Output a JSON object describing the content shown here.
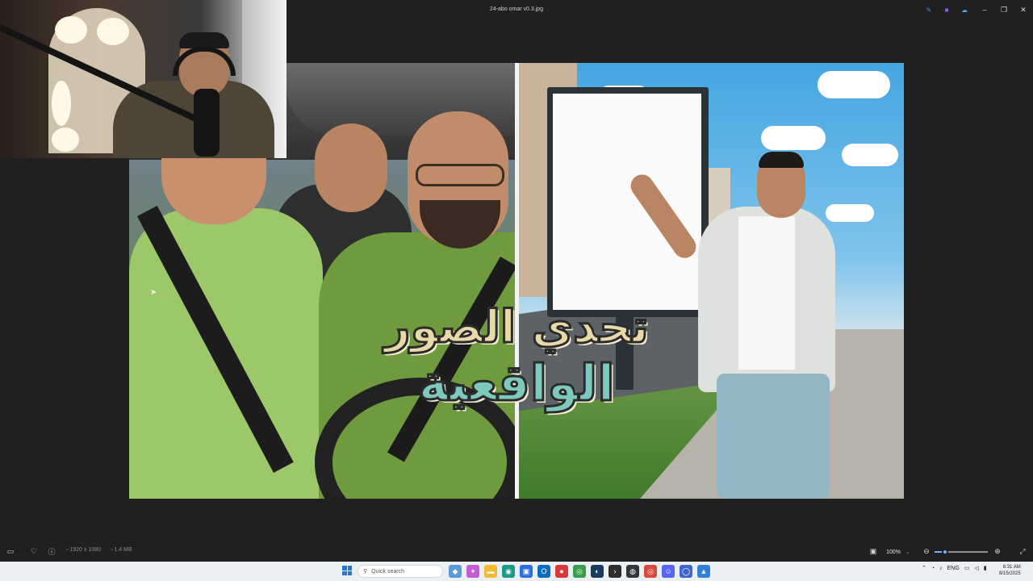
{
  "window": {
    "title": "24-abo omar v0.3.jpg",
    "titlebar_icons": [
      {
        "name": "edit-pen-icon",
        "glyph": "✎",
        "color": "#3c8dff"
      },
      {
        "name": "clipchamp-icon",
        "glyph": "■",
        "color": "#8a5cf6"
      },
      {
        "name": "onedrive-icon",
        "glyph": "☁",
        "color": "#4aa3ff"
      }
    ],
    "controls": {
      "minimize": "–",
      "maximize": "❐",
      "close": "✕"
    }
  },
  "image": {
    "thumbnail_title_line1": "تحدي الصور",
    "thumbnail_title_line2": "الواقعية"
  },
  "status": {
    "dimensions": "1920 x 1080",
    "filesize": "1.4 MB",
    "zoom": "100%",
    "zoom_level_percent": 20
  },
  "taskbar": {
    "search_placeholder": "Quick search",
    "apps": [
      {
        "name": "widgets-app-icon",
        "glyph": "◆",
        "color": "#5a9bd8"
      },
      {
        "name": "copilot-app-icon",
        "glyph": "✦",
        "color": "#c45cd8"
      },
      {
        "name": "file-explorer-app-icon",
        "glyph": "▬",
        "color": "#f1b92e"
      },
      {
        "name": "edge-app-icon",
        "glyph": "◉",
        "color": "#1d9a86"
      },
      {
        "name": "store-app-icon",
        "glyph": "▣",
        "color": "#2a6fdb"
      },
      {
        "name": "outlook-app-icon",
        "glyph": "O",
        "color": "#0f6cbd"
      },
      {
        "name": "record-app-icon",
        "glyph": "●",
        "color": "#d73a3a"
      },
      {
        "name": "chrome-app-icon",
        "glyph": "◎",
        "color": "#3a9b4a"
      },
      {
        "name": "steam-app-icon",
        "glyph": "◐",
        "color": "#1b3b5c"
      },
      {
        "name": "terminal-app-icon",
        "glyph": "›",
        "color": "#2d2d2d"
      },
      {
        "name": "obs-app-icon",
        "glyph": "◍",
        "color": "#30353a"
      },
      {
        "name": "chrome-alt-app-icon",
        "glyph": "◎",
        "color": "#d94a3b"
      },
      {
        "name": "discord-app-icon",
        "glyph": "☺",
        "color": "#5865f2"
      },
      {
        "name": "browser-app-icon",
        "glyph": "◯",
        "color": "#4263c9"
      },
      {
        "name": "photos-app-icon",
        "glyph": "▲",
        "color": "#2e7fd6"
      }
    ],
    "tray_language": "ENG",
    "time": "6:31 AM",
    "date": "8/15/2025"
  }
}
